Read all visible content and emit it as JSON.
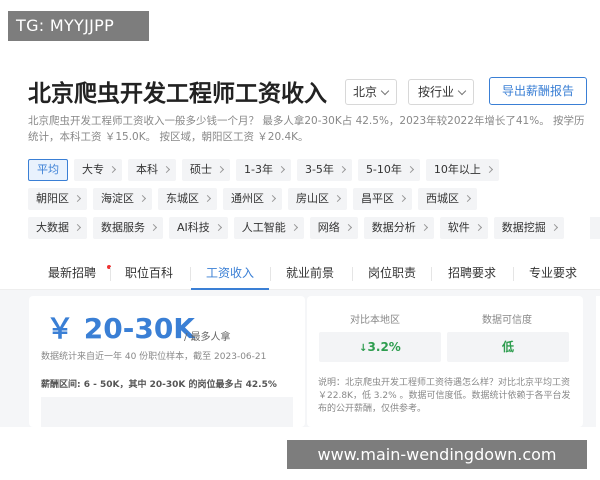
{
  "watermark_top": "TG: MYYJJPP",
  "watermark_bottom": "www.main-wendingdown.com",
  "header": {
    "title": "北京爬虫开发工程师工资收入",
    "city": "北京",
    "industry": "按行业",
    "export_label": "导出薪酬报告"
  },
  "description": "北京爬虫开发工程师工资收入一般多少钱一个月？ 最多人拿20-30K占 42.5%，2023年较2022年增长了41%。 按学历统计，本科工资 ￥15.0K。 按区域，朝阳区工资 ￥20.4K。",
  "filters": {
    "row1": [
      "平均",
      "大专",
      "本科",
      "硕士",
      "1-3年",
      "3-5年",
      "5-10年",
      "10年以上"
    ],
    "row2": [
      "朝阳区",
      "海淀区",
      "东城区",
      "通州区",
      "房山区",
      "昌平区",
      "西城区"
    ],
    "row3": [
      "大数据",
      "数据服务",
      "AI科技",
      "人工智能",
      "网络",
      "数据分析",
      "软件",
      "数据挖掘"
    ]
  },
  "tabs": [
    "最新招聘",
    "职位百科",
    "工资收入",
    "就业前景",
    "岗位职责",
    "招聘要求",
    "专业要求"
  ],
  "active_tab": "工资收入",
  "salary": {
    "range": "￥ 20-30K",
    "suffix": "/ 最多人拿",
    "stat_note": "数据统计来自近一年 40 份职位样本，截至 2023-06-21",
    "range_note": "薪酬区间: 6 - 50K，其中 20-30K 的岗位最多占 42.5%"
  },
  "comparison": {
    "local_label": "对比本地区",
    "local_value": "3.2%",
    "trust_label": "数据可信度",
    "trust_value": "低",
    "note": "说明：北京爬虫开发工程师工资待遇怎么样？对比北京平均工资 ￥22.8K，低 3.2% 。数据可信度低。数据统计依赖于各平台发布的公开薪酬，仅供参考。"
  },
  "colors": {
    "accent": "#3a7fd5",
    "positive": "#2e9d4f",
    "new_dot": "#e33333"
  }
}
